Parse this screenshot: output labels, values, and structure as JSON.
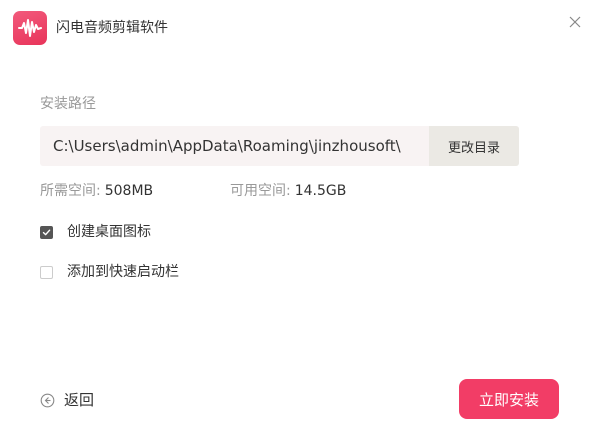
{
  "app": {
    "title": "闪电音频剪辑软件",
    "accent_color": "#f23d66"
  },
  "icons": {
    "logo": "audio-waveform-icon",
    "close": "close-icon",
    "check": "check-icon",
    "back": "back-arrow-circle-icon"
  },
  "install_path": {
    "label": "安装路径",
    "value": "C:\\Users\\admin\\AppData\\Roaming\\jinzhousoft\\",
    "change_button": "更改目录"
  },
  "space": {
    "required_label": "所需空间:",
    "required_value": "508MB",
    "available_label": "可用空间:",
    "available_value": "14.5GB"
  },
  "options": {
    "desktop_shortcut": {
      "label": "创建桌面图标",
      "checked": true
    },
    "quick_launch": {
      "label": "添加到快速启动栏",
      "checked": false
    }
  },
  "footer": {
    "back_label": "返回",
    "install_label": "立即安装"
  }
}
